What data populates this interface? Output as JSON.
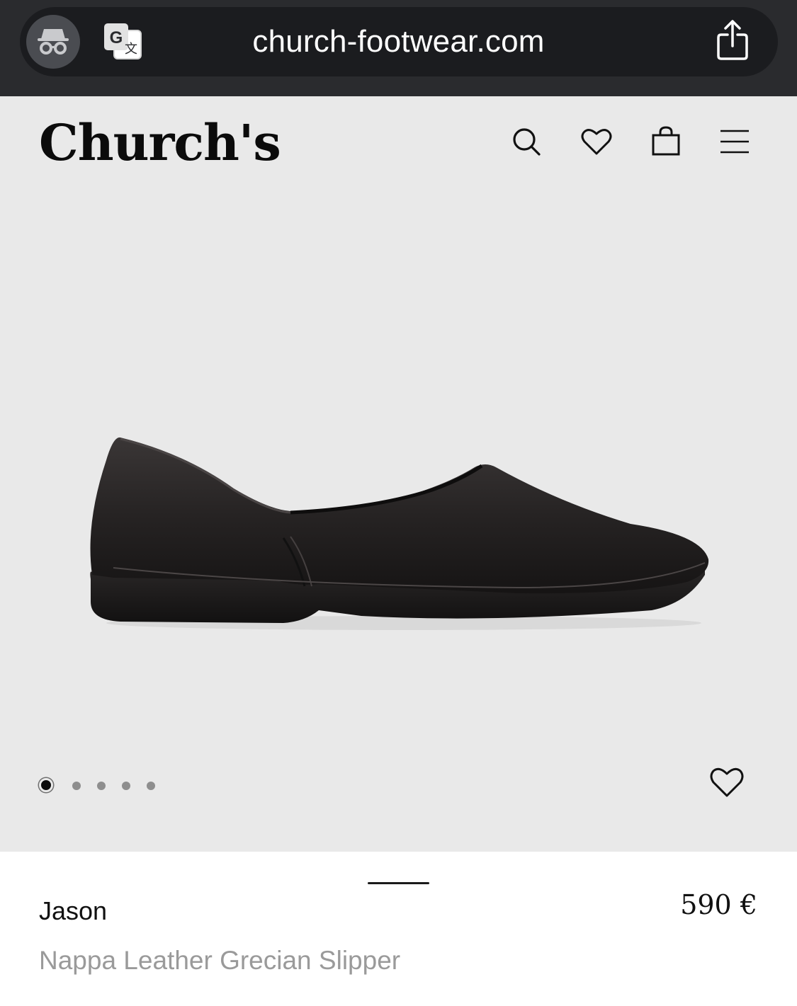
{
  "browser": {
    "url": "church-footwear.com",
    "icons": {
      "left_primary": "incognito-icon",
      "left_secondary": "translate-icon",
      "right": "share-icon"
    }
  },
  "header": {
    "logo_text": "Church's",
    "icons": [
      "search-icon",
      "heart-icon",
      "shopping-bag-icon",
      "menu-icon"
    ]
  },
  "gallery": {
    "image": "black-nappa-leather-slipper-side-view",
    "slide_count": 5,
    "active_slide": 1,
    "favourite_icon": "heart-icon"
  },
  "product": {
    "name": "Jason",
    "price": "590 €",
    "subtitle": "Nappa Leather Grecian Slipper"
  },
  "colors": {
    "browser_bar": "#2a2b2e",
    "page_background": "#e9e9e9",
    "text_primary": "#111111",
    "text_secondary": "#9a9a9a"
  }
}
